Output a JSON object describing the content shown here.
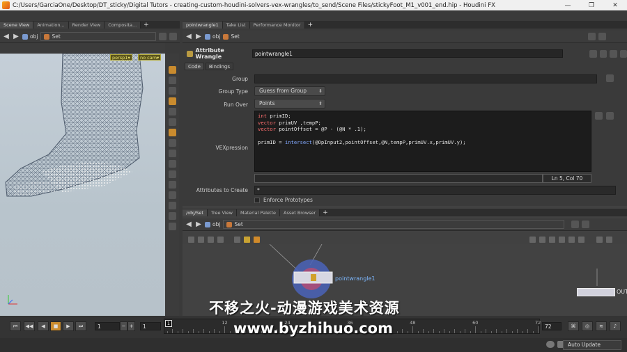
{
  "window": {
    "title": "C:/Users/GarciaOne/Desktop/DT_sticky/Digital Tutors - creating-custom-houdini-solvers-vex-wrangles/to_send/Scene Files/stickyFoot_M1_v001_end.hip - Houdini FX",
    "minimize": "—",
    "maximize": "❐",
    "close": "✕"
  },
  "left_pane": {
    "tabs": [
      "Scene View",
      "Animation...",
      "Render View",
      "Composita..."
    ],
    "path": {
      "context": "obj",
      "node": "Set"
    },
    "viewport": {
      "camera_menu": "persp1▾",
      "cam_menu": "no cam▾"
    }
  },
  "param_pane": {
    "tabs": [
      "pointwrangle1",
      "Take List",
      "Performance Monitor"
    ],
    "path": {
      "context": "obj",
      "node": "Set"
    },
    "node_type": "Attribute Wrangle",
    "node_name": "pointwrangle1",
    "sub_tabs": [
      "Code",
      "Bindings"
    ],
    "labels": {
      "group": "Group",
      "group_type": "Group Type",
      "run_over": "Run Over",
      "vexpression": "VEXpression",
      "attributes_to_create": "Attributes to Create",
      "enforce_prototypes": "Enforce Prototypes"
    },
    "values": {
      "group": "",
      "group_type": "Guess from Group",
      "run_over": "Points",
      "attributes_to_create": "*"
    },
    "code": {
      "l1_kw": "int",
      "l1_rest": " primID;",
      "l2_kw": "vector",
      "l2_rest": " primUV ,tempP;",
      "l3_kw": "vector",
      "l3_rest": " pointOffset = @P - (@N * .1);",
      "l5_pre": "primID = ",
      "l5_fn": "intersect",
      "l5_post": "(@OpInput2,pointOffset,@N,tempP,primUV.x,primUV.y);"
    },
    "cursor_status": "Ln 5, Col 70"
  },
  "network_pane": {
    "tabs": [
      "/obj/Set",
      "Tree View",
      "Material Palette",
      "Asset Browser"
    ],
    "path": {
      "context": "obj",
      "node": "Set"
    },
    "node_label": "pointwrangle1",
    "out_label": "OUT"
  },
  "timeline": {
    "current_frame": "1",
    "start_frame": "1",
    "end_frame": "72",
    "ruler_frame": "1",
    "tick_labels": [
      "12",
      "24",
      "36",
      "48",
      "60",
      "72"
    ],
    "step_minus": "−",
    "step_plus": "+"
  },
  "statusbar": {
    "auto_update": "Auto Update"
  },
  "watermark": {
    "line1": "不移之火-动漫游戏美术资源",
    "line2": "www.byzhihuo.com"
  }
}
